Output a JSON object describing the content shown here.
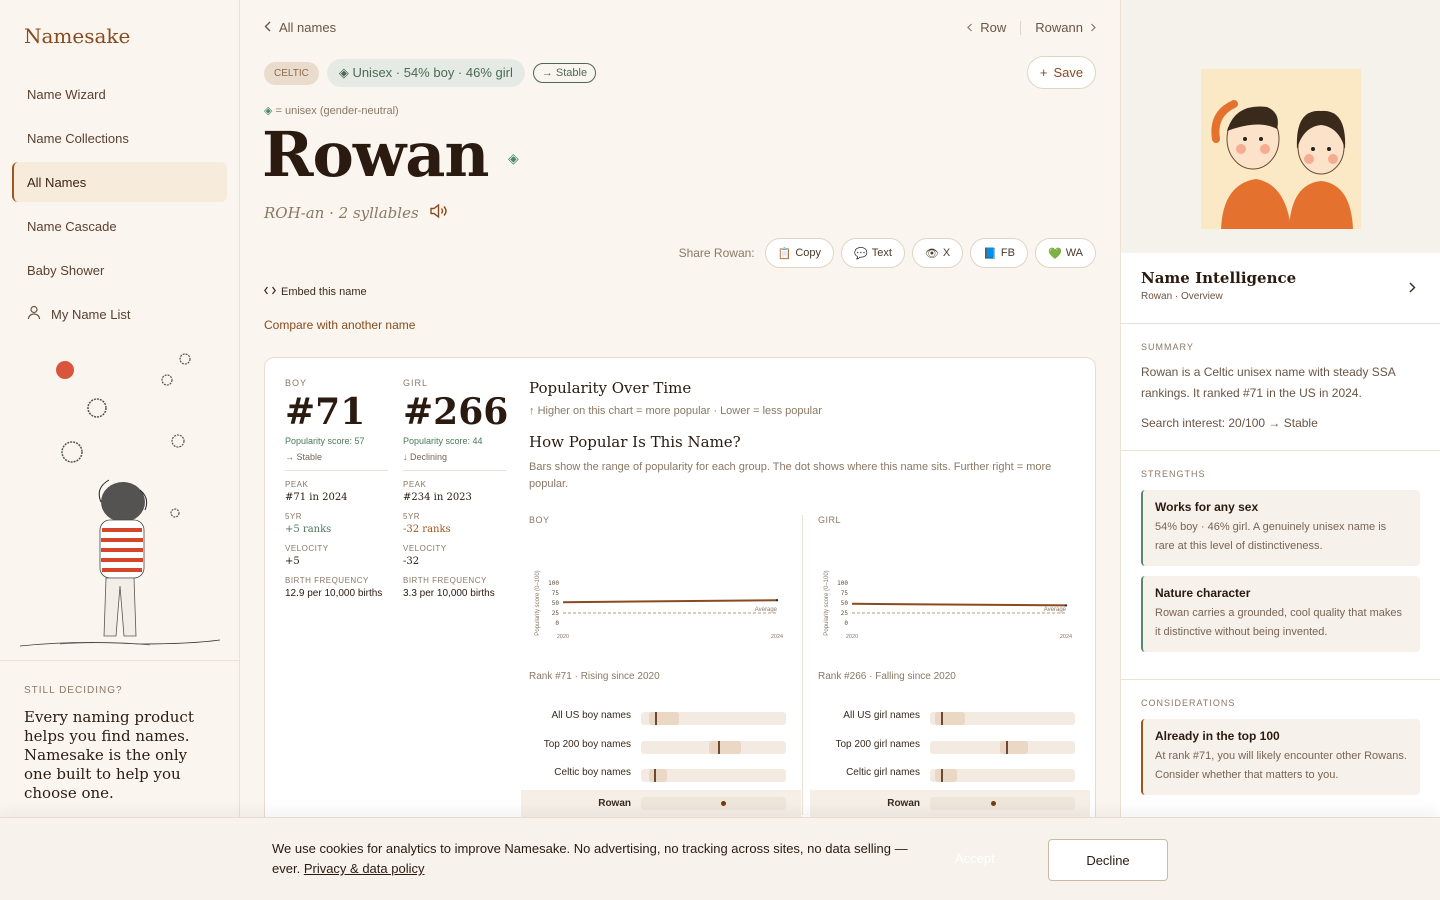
{
  "app": {
    "logo": "Namesake"
  },
  "sidebar": {
    "items": [
      {
        "label": "Name Wizard"
      },
      {
        "label": "Name Collections"
      },
      {
        "label": "All Names"
      },
      {
        "label": "Name Cascade"
      },
      {
        "label": "Baby Shower"
      },
      {
        "label": "My Name List"
      }
    ],
    "still_label": "STILL DECIDING?",
    "still_text": "Every naming product helps you find names. Namesake is the only one built to help you choose one."
  },
  "topnav": {
    "back": "All names",
    "prev": "Row",
    "next": "Rowann"
  },
  "tags": {
    "origin": "CELTIC",
    "gender": "Unisex · 54% boy · 46% girl",
    "trend": "→ Stable"
  },
  "save_label": "Save",
  "legend_note": "= unisex (gender-neutral)",
  "name": "Rowan",
  "pronunciation": "ROH-an · 2 syllables",
  "share": {
    "label": "Share Rowan:",
    "buttons": [
      "Copy",
      "Text",
      "X",
      "FB",
      "WA"
    ]
  },
  "embed": "Embed this name",
  "compare": "Compare with another name",
  "stats": {
    "boy": {
      "label": "BOY",
      "rank": "#71",
      "score": "Popularity score: 57",
      "trend": "→ Stable",
      "peak_label": "PEAK",
      "peak": "#71 in 2024",
      "fiveyr_label": "5YR",
      "fiveyr": "+5 ranks",
      "velocity_label": "VELOCITY",
      "velocity": "+5",
      "birth_label": "BIRTH FREQUENCY",
      "birth": "12.9 per 10,000 births"
    },
    "girl": {
      "label": "GIRL",
      "rank": "#266",
      "score": "Popularity score: 44",
      "trend": "↓ Declining",
      "peak_label": "PEAK",
      "peak": "#234 in 2023",
      "fiveyr_label": "5YR",
      "fiveyr": "-32 ranks",
      "velocity_label": "VELOCITY",
      "velocity": "-32",
      "birth_label": "BIRTH FREQUENCY",
      "birth": "3.3 per 10,000 births"
    }
  },
  "popularity": {
    "title": "Popularity Over Time",
    "sub": "Higher on this chart = more popular · Lower = less popular",
    "how_title": "How Popular Is This Name?",
    "how_sub": "Bars show the range of popularity for each group. The dot shows where this name sits. Further right = more popular."
  },
  "chart_data": [
    {
      "type": "line",
      "title": "BOY",
      "ylabel": "Popularity score (0–100)",
      "x": [
        2020,
        2024
      ],
      "ylim": [
        0,
        100
      ],
      "yticks": [
        0,
        25,
        50,
        75,
        100
      ],
      "series": [
        {
          "values": [
            52,
            57
          ]
        }
      ],
      "reference": {
        "label": "Average",
        "value": 25
      }
    },
    {
      "type": "line",
      "title": "GIRL",
      "ylabel": "Popularity score (0–100)",
      "x": [
        2020,
        2024
      ],
      "ylim": [
        0,
        100
      ],
      "yticks": [
        0,
        25,
        50,
        75,
        100
      ],
      "series": [
        {
          "values": [
            48,
            44
          ]
        }
      ],
      "reference": {
        "label": "Average",
        "value": 25
      }
    }
  ],
  "ranks": {
    "boy": {
      "title": "Rank #71 · Rising since 2020",
      "rows": [
        "All US boy names",
        "Top 200 boy names",
        "Celtic boy names"
      ],
      "highlight": "Rowan"
    },
    "girl": {
      "title": "Rank #266 · Falling since 2020",
      "rows": [
        "All US girl names",
        "Top 200 girl names",
        "Celtic girl names"
      ],
      "highlight": "Rowan"
    }
  },
  "right": {
    "title": "Name Intelligence",
    "sub": "Rowan · Overview",
    "summary_label": "SUMMARY",
    "summary": "Rowan is a Celtic unisex name with steady SSA rankings. It ranked #71 in the US in 2024.",
    "search_interest": "Search interest: 20/100 → Stable",
    "strengths_label": "STRENGTHS",
    "strengths": [
      {
        "title": "Works for any sex",
        "body": "54% boy · 46% girl. A genuinely unisex name is rare at this level of distinctiveness."
      },
      {
        "title": "Nature character",
        "body": "Rowan carries a grounded, cool quality that makes it distinctive without being invented."
      }
    ],
    "considerations_label": "CONSIDERATIONS",
    "considerations": [
      {
        "title": "Already in the top 100",
        "body": "At rank #71, you will likely encounter other Rowans. Consider whether that matters to you."
      }
    ]
  },
  "cookie": {
    "message": "We use cookies for analytics to improve Namesake. No advertising, no tracking across sites, no data selling — ever.",
    "policy_link": "Privacy & data policy",
    "accept": "Accept",
    "decline": "Decline"
  }
}
